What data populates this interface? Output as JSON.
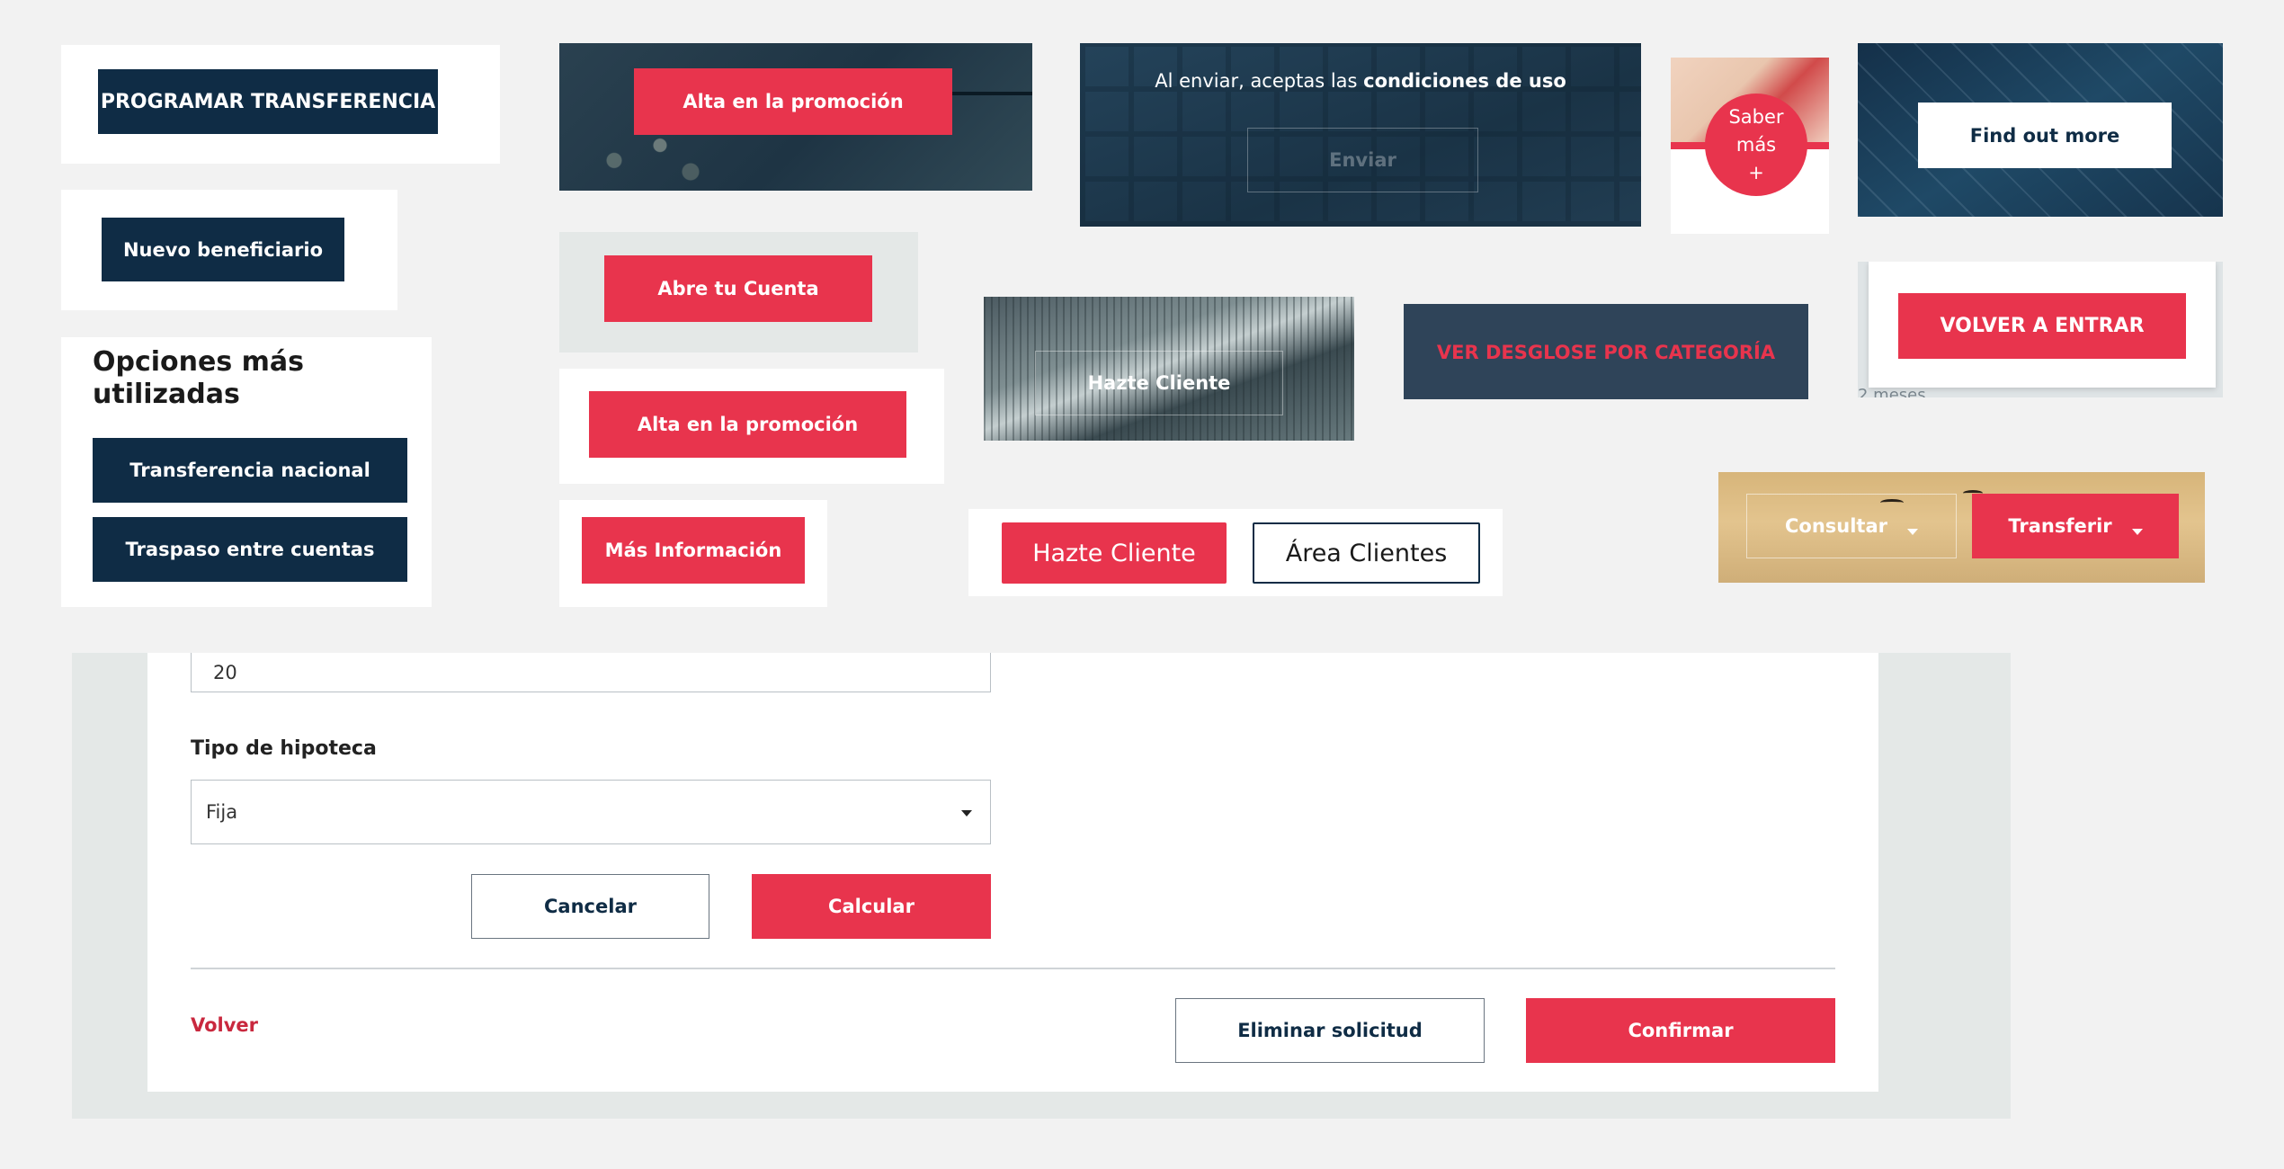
{
  "programar": {
    "label": "PROGRAMAR TRANSFERENCIA"
  },
  "nuevo_beneficiario": {
    "label": "Nuevo beneficiario"
  },
  "opciones": {
    "title": "Opciones más utilizadas",
    "btn_nacional": "Transferencia nacional",
    "btn_traspaso": "Traspaso entre cuentas"
  },
  "promo_top": {
    "label": "Alta en la promoción"
  },
  "abre_cuenta": {
    "label": "Abre tu Cuenta"
  },
  "promo_bottom": {
    "label": "Alta en la promoción"
  },
  "mas_info": {
    "label": "Más Información"
  },
  "enviar_banner": {
    "text_prefix": "Al enviar, aceptas las",
    "text_bold": "condiciones de uso",
    "button": "Enviar"
  },
  "hazte_photo": {
    "label": "Hazte Cliente"
  },
  "hazte_area": {
    "primary": "Hazte Cliente",
    "secondary": "Área Clientes"
  },
  "saber_mas": {
    "line1": "Saber",
    "line2": "más",
    "plus": "+"
  },
  "desglose": {
    "label": "VER DESGLOSE POR CATEGORÍA"
  },
  "find_out": {
    "label": "Find out more"
  },
  "volver_entrar": {
    "label": "VOLVER A ENTRAR",
    "bg_text": "2 meses"
  },
  "sunset_banner": {
    "consultar": "Consultar",
    "transferir": "Transferir"
  },
  "form": {
    "years_value": "20",
    "tipo_label": "Tipo de hipoteca",
    "tipo_value": "Fija",
    "cancel": "Cancelar",
    "calculate": "Calcular",
    "back": "Volver",
    "delete": "Eliminar solicitud",
    "confirm": "Confirmar"
  },
  "colors": {
    "navy": "#0f2c45",
    "red": "#e8344d",
    "panel_bg": "#e4e8e7"
  }
}
